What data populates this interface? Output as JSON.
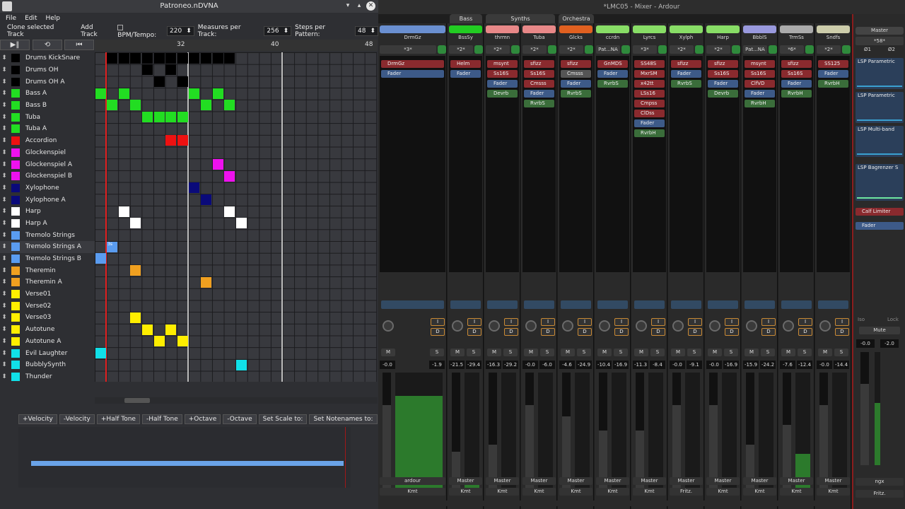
{
  "patroneo": {
    "title": "Patroneo.nDVNA",
    "menu": [
      "File",
      "Edit",
      "Help"
    ],
    "toolbar": {
      "clone": "Clone selected Track",
      "add": "Add Track",
      "bpm_label": "BPM/Tempo:",
      "bpm": "220",
      "measures_label": "Measures per Track:",
      "measures": "256",
      "steps_label": "Steps per Pattern:",
      "steps": "48"
    },
    "ruler": [
      "32",
      "40",
      "48"
    ],
    "tracks": [
      {
        "name": "Drums KickSnare",
        "color": "#000000"
      },
      {
        "name": "Drums OH",
        "color": "#000000"
      },
      {
        "name": "Drums OH A",
        "color": "#000000"
      },
      {
        "name": "Bass A",
        "color": "#22dd22"
      },
      {
        "name": "Bass B",
        "color": "#22dd22"
      },
      {
        "name": "Tuba",
        "color": "#22dd22"
      },
      {
        "name": "Tuba A",
        "color": "#22dd22"
      },
      {
        "name": "Accordion",
        "color": "#ee1111"
      },
      {
        "name": "Glockenspiel",
        "color": "#ee11ee"
      },
      {
        "name": "Glockenspiel A",
        "color": "#ee11ee"
      },
      {
        "name": "Glockenspiel B",
        "color": "#ee11ee"
      },
      {
        "name": "Xylophone",
        "color": "#0a0a7a"
      },
      {
        "name": "Xylophone A",
        "color": "#0a0a7a"
      },
      {
        "name": "Harp",
        "color": "#ffffff"
      },
      {
        "name": "Harp A",
        "color": "#ffffff"
      },
      {
        "name": "Tremolo Strings",
        "color": "#5a9cf0"
      },
      {
        "name": "Tremolo Strings A",
        "color": "#5a9cf0"
      },
      {
        "name": "Tremolo Strings B",
        "color": "#5a9cf0"
      },
      {
        "name": "Theremin",
        "color": "#f0a020"
      },
      {
        "name": "Theremin A",
        "color": "#f0a020"
      },
      {
        "name": "Verse01",
        "color": "#ffee00"
      },
      {
        "name": "Verse02",
        "color": "#ffee00"
      },
      {
        "name": "Verse03",
        "color": "#ffee00"
      },
      {
        "name": "Autotune",
        "color": "#ffee00"
      },
      {
        "name": "Autotune A",
        "color": "#ffee00"
      },
      {
        "name": "Evil Laughter",
        "color": "#11e0e8"
      },
      {
        "name": "BubblySynth",
        "color": "#11e0e8"
      },
      {
        "name": "Thunder",
        "color": "#11e0e8"
      }
    ],
    "cells": [
      {
        "r": 0,
        "c": 1,
        "color": "#000000"
      },
      {
        "r": 0,
        "c": 2,
        "color": "#000000"
      },
      {
        "r": 0,
        "c": 3,
        "color": "#000000"
      },
      {
        "r": 0,
        "c": 4,
        "color": "#000000"
      },
      {
        "r": 0,
        "c": 5,
        "color": "#000000"
      },
      {
        "r": 0,
        "c": 6,
        "color": "#000000"
      },
      {
        "r": 0,
        "c": 7,
        "color": "#000000"
      },
      {
        "r": 0,
        "c": 8,
        "color": "#000000"
      },
      {
        "r": 0,
        "c": 9,
        "color": "#000000"
      },
      {
        "r": 0,
        "c": 10,
        "color": "#000000"
      },
      {
        "r": 0,
        "c": 11,
        "color": "#000000"
      },
      {
        "r": 1,
        "c": 4,
        "color": "#000000"
      },
      {
        "r": 1,
        "c": 6,
        "color": "#000000"
      },
      {
        "r": 2,
        "c": 5,
        "color": "#000000"
      },
      {
        "r": 2,
        "c": 7,
        "color": "#000000"
      },
      {
        "r": 3,
        "c": 0,
        "color": "#22dd22"
      },
      {
        "r": 3,
        "c": 2,
        "color": "#22dd22"
      },
      {
        "r": 3,
        "c": 8,
        "color": "#22dd22"
      },
      {
        "r": 3,
        "c": 10,
        "color": "#22dd22"
      },
      {
        "r": 4,
        "c": 1,
        "color": "#22dd22"
      },
      {
        "r": 4,
        "c": 3,
        "color": "#22dd22"
      },
      {
        "r": 4,
        "c": 9,
        "color": "#22dd22"
      },
      {
        "r": 4,
        "c": 11,
        "color": "#22dd22"
      },
      {
        "r": 5,
        "c": 4,
        "color": "#22dd22"
      },
      {
        "r": 5,
        "c": 5,
        "color": "#22dd22"
      },
      {
        "r": 5,
        "c": 6,
        "color": "#22dd22"
      },
      {
        "r": 5,
        "c": 7,
        "color": "#22dd22"
      },
      {
        "r": 7,
        "c": 6,
        "color": "#ee1111"
      },
      {
        "r": 7,
        "c": 7,
        "color": "#ee1111"
      },
      {
        "r": 9,
        "c": 10,
        "color": "#ee11ee"
      },
      {
        "r": 10,
        "c": 11,
        "color": "#ee11ee"
      },
      {
        "r": 11,
        "c": 8,
        "color": "#0a0a7a"
      },
      {
        "r": 12,
        "c": 9,
        "color": "#0a0a7a"
      },
      {
        "r": 13,
        "c": 2,
        "color": "#ffffff"
      },
      {
        "r": 13,
        "c": 11,
        "color": "#ffffff"
      },
      {
        "r": 14,
        "c": 3,
        "color": "#ffffff"
      },
      {
        "r": 14,
        "c": 12,
        "color": "#ffffff"
      },
      {
        "r": 16,
        "c": 1,
        "color": "#5a9cf0"
      },
      {
        "r": 17,
        "c": 0,
        "color": "#5a9cf0"
      },
      {
        "r": 18,
        "c": 3,
        "color": "#f0a020"
      },
      {
        "r": 19,
        "c": 9,
        "color": "#f0a020"
      },
      {
        "r": 22,
        "c": 3,
        "color": "#ffee00"
      },
      {
        "r": 23,
        "c": 4,
        "color": "#ffee00"
      },
      {
        "r": 23,
        "c": 6,
        "color": "#ffee00"
      },
      {
        "r": 24,
        "c": 5,
        "color": "#ffee00"
      },
      {
        "r": 24,
        "c": 7,
        "color": "#ffee00"
      },
      {
        "r": 25,
        "c": 0,
        "color": "#11e0e8"
      },
      {
        "r": 26,
        "c": 12,
        "color": "#11e0e8"
      }
    ],
    "cell_label": "3s",
    "note_buttons": [
      "+Velocity",
      "-Velocity",
      "+Half Tone",
      "-Half Tone",
      "+Octave",
      "-Octave",
      "Set Scale to:",
      "Set Notenames to:"
    ]
  },
  "ardour": {
    "title": "*LMC05 - Mixer - Ardour",
    "groups": [
      "Bass",
      "Synths",
      "Orchestra"
    ],
    "strips": [
      {
        "name": "DrmGz",
        "color": "#6a8fd0",
        "input": "*3*",
        "gain": "-0.0",
        "peak": "-1.9",
        "out": "ardour",
        "comment": "Kmt",
        "plugins": [
          [
            "DrmGz",
            "r"
          ],
          [
            "Fader",
            "b"
          ]
        ],
        "fader": 0.72,
        "meter": 0.8,
        "wide": true
      },
      {
        "name": "BssSy",
        "color": "#22cc22",
        "input": "*2*",
        "gain": "-21.5",
        "peak": "-29.4",
        "out": "Master",
        "comment": "Kmt",
        "plugins": [
          [
            "Helm",
            "r"
          ],
          [
            "Fader",
            "b"
          ]
        ],
        "fader": 0.32,
        "meter": 0.05
      },
      {
        "name": "thrmn",
        "color": "#e88888",
        "input": "*2*",
        "gain": "-16.3",
        "peak": "-29.2",
        "out": "Master",
        "comment": "Kmt",
        "plugins": [
          [
            "msynt",
            "r"
          ],
          [
            "Ss16S",
            "r"
          ],
          [
            "Fader",
            "b"
          ],
          [
            "Devrb",
            "g"
          ]
        ],
        "fader": 0.38,
        "meter": 0
      },
      {
        "name": "Tuba",
        "color": "#e88888",
        "input": "*2*",
        "gain": "-0.0",
        "peak": "-6.0",
        "out": "Master",
        "comment": "Kmt",
        "plugins": [
          [
            "sfizz",
            "r"
          ],
          [
            "Ss16S",
            "r"
          ],
          [
            "Cmsss",
            "r"
          ],
          [
            "Fader",
            "b"
          ],
          [
            "RvrbS",
            "g"
          ]
        ],
        "fader": 0.72,
        "meter": 0
      },
      {
        "name": "Glcks",
        "color": "#e06020",
        "input": "*2*",
        "gain": "-4.6",
        "peak": "-24.9",
        "out": "Master",
        "comment": "Kmt",
        "plugins": [
          [
            "sfizz",
            "r"
          ],
          [
            "Cmsss",
            "gr"
          ],
          [
            "Fader",
            "b"
          ],
          [
            "RvrbS",
            "g"
          ]
        ],
        "fader": 0.62,
        "meter": 0
      },
      {
        "name": "ccrdn",
        "color": "#88dd66",
        "input": "Pat...NA",
        "gain": "-10.4",
        "peak": "-16.9",
        "out": "Master",
        "comment": "Kmt",
        "plugins": [
          [
            "GnMDS",
            "r"
          ],
          [
            "Fader",
            "b"
          ],
          [
            "RvrbS",
            "g"
          ]
        ],
        "fader": 0.5,
        "meter": 0
      },
      {
        "name": "Lyrcs",
        "color": "#88dd66",
        "input": "*3*",
        "gain": "-11.3",
        "peak": "-8.4",
        "out": "Master",
        "comment": "Kmt",
        "plugins": [
          [
            "SS48S",
            "r"
          ],
          [
            "MxrSM",
            "r"
          ],
          [
            "x42tt",
            "r"
          ],
          [
            "LSs16",
            "r"
          ],
          [
            "Cmpss",
            "r"
          ],
          [
            "ClDss",
            "r"
          ],
          [
            "Fader",
            "b"
          ],
          [
            "RvrbH",
            "g"
          ]
        ],
        "fader": 0.5,
        "meter": 0
      },
      {
        "name": "Xylph",
        "color": "#88dd66",
        "input": "*2*",
        "gain": "-0.0",
        "peak": "-9.1",
        "out": "Master",
        "comment": "Fritz.",
        "plugins": [
          [
            "sfizz",
            "r"
          ],
          [
            "Fader",
            "b"
          ],
          [
            "RvrbS",
            "g"
          ]
        ],
        "fader": 0.72,
        "meter": 0
      },
      {
        "name": "Harp",
        "color": "#88dd66",
        "input": "*2*",
        "gain": "-0.0",
        "peak": "-16.9",
        "out": "Master",
        "comment": "Kmt",
        "plugins": [
          [
            "sfizz",
            "r"
          ],
          [
            "Ss16S",
            "r"
          ],
          [
            "Fader",
            "b"
          ],
          [
            "Devrb",
            "g"
          ]
        ],
        "fader": 0.72,
        "meter": 0
      },
      {
        "name": "BbblS",
        "color": "#9999dd",
        "input": "Pat...NA",
        "gain": "-15.9",
        "peak": "-24.2",
        "out": "Master",
        "comment": "Kmt",
        "plugins": [
          [
            "msynt",
            "r"
          ],
          [
            "Ss16S",
            "r"
          ],
          [
            "ClfVD",
            "r"
          ],
          [
            "Fader",
            "b"
          ],
          [
            "RvrbH",
            "g"
          ]
        ],
        "fader": 0.38,
        "meter": 0
      },
      {
        "name": "TrmSs",
        "color": "#aaaaaa",
        "input": "*6*",
        "gain": "-7.6",
        "peak": "-12.4",
        "out": "Master",
        "comment": "Kmt",
        "plugins": [
          [
            "sfizz",
            "r"
          ],
          [
            "Ss16S",
            "r"
          ],
          [
            "Fader",
            "b"
          ],
          [
            "RvrbH",
            "g"
          ]
        ],
        "fader": 0.55,
        "meter": 0.3
      },
      {
        "name": "Sndfs",
        "color": "#ccccaa",
        "input": "*2*",
        "gain": "-0.0",
        "peak": "-14.4",
        "out": "Master",
        "comment": "Kmt",
        "plugins": [
          [
            "SS125",
            "r"
          ],
          [
            "Fader",
            "b"
          ],
          [
            "RvrbH",
            "g"
          ]
        ],
        "fader": 0.72,
        "meter": 0
      }
    ],
    "master": {
      "name": "Master",
      "input": "*58*",
      "plugins": [
        "LSP Parametric",
        "LSP Parametric",
        "LSP Multi-band",
        "LSP Bagrenzer S"
      ],
      "limiter": "Calf Limiter",
      "fader": "Fader",
      "mute": "Mute",
      "gain": "-0.0",
      "peak": "-2.0",
      "out": "ngx",
      "comment": "Fritz.",
      "iso": "Iso",
      "lock": "Lock",
      "btn1": "Ø1",
      "btn2": "Ø2"
    }
  }
}
